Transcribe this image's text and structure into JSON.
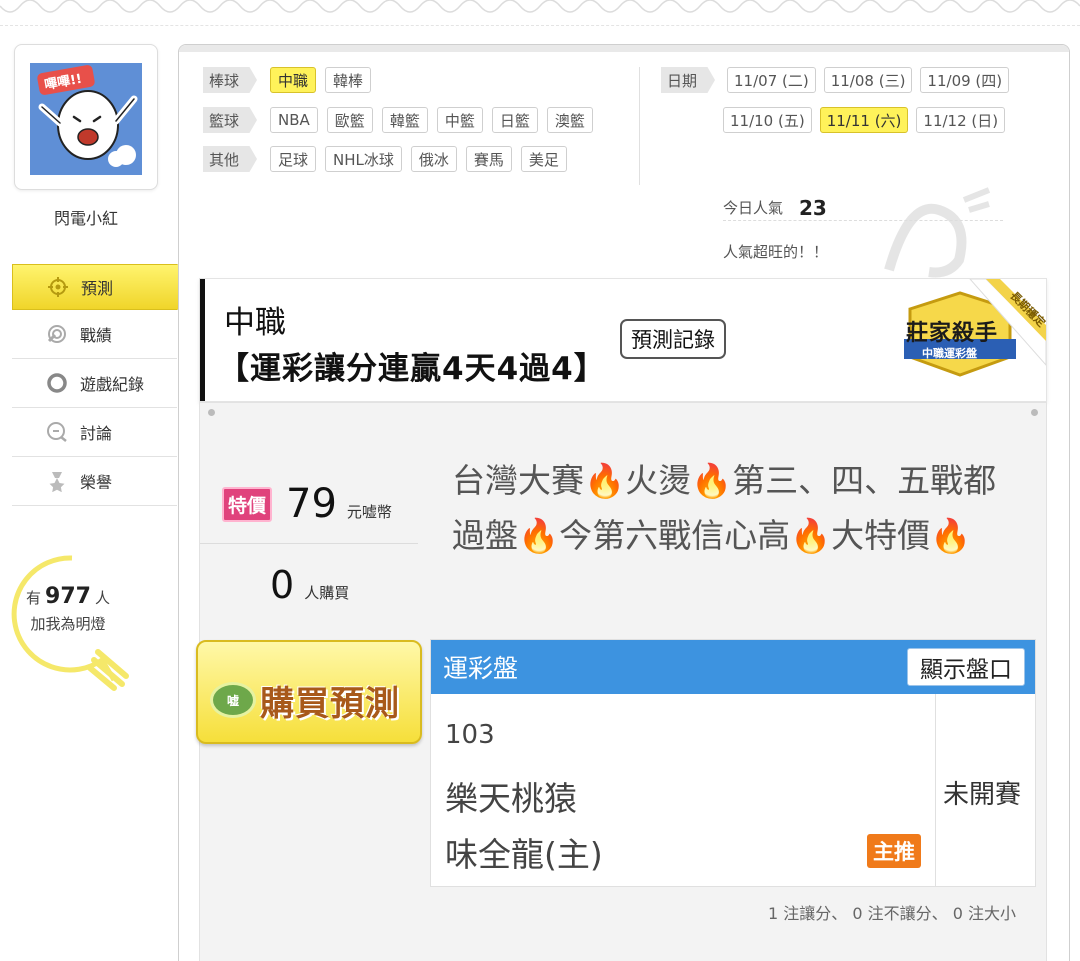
{
  "user": {
    "name": "閃電小紅",
    "avatar_text": "嗶嗶!!"
  },
  "side_nav": [
    {
      "label": "預測",
      "icon": "target-icon",
      "active": true
    },
    {
      "label": "戰績",
      "icon": "record-icon",
      "active": false
    },
    {
      "label": "遊戲紀錄",
      "icon": "circle-icon",
      "active": false
    },
    {
      "label": "討論",
      "icon": "chat-icon",
      "active": false
    },
    {
      "label": "榮譽",
      "icon": "medal-icon",
      "active": false
    }
  ],
  "fans": {
    "prefix": "有",
    "count": "977",
    "suffix": "人",
    "cta": "加我為明燈"
  },
  "categories": [
    {
      "label": "棒球",
      "items": [
        {
          "text": "中職",
          "selected": true
        },
        {
          "text": "韓棒",
          "selected": false
        }
      ]
    },
    {
      "label": "籃球",
      "items": [
        {
          "text": "NBA",
          "selected": false
        },
        {
          "text": "歐籃",
          "selected": false
        },
        {
          "text": "韓籃",
          "selected": false
        },
        {
          "text": "中籃",
          "selected": false
        },
        {
          "text": "日籃",
          "selected": false
        },
        {
          "text": "澳籃",
          "selected": false
        }
      ]
    },
    {
      "label": "其他",
      "items": [
        {
          "text": "足球",
          "selected": false
        },
        {
          "text": "NHL冰球",
          "selected": false
        },
        {
          "text": "俄冰",
          "selected": false
        },
        {
          "text": "賽馬",
          "selected": false
        },
        {
          "text": "美足",
          "selected": false
        }
      ]
    }
  ],
  "dates": {
    "label": "日期",
    "row1": [
      {
        "text": "11/07 (二)",
        "selected": false
      },
      {
        "text": "11/08 (三)",
        "selected": false
      },
      {
        "text": "11/09 (四)",
        "selected": false
      }
    ],
    "row2": [
      {
        "text": "11/10 (五)",
        "selected": false
      },
      {
        "text": "11/11 (六)",
        "selected": true
      },
      {
        "text": "11/12 (日)",
        "selected": false
      }
    ]
  },
  "popularity": {
    "label": "今日人氣",
    "value": "23",
    "message": "人氣超旺的！！"
  },
  "prediction": {
    "league": "中職",
    "subtitle": "【運彩讓分連贏4天4過4】",
    "record_button": "預測記錄",
    "badge_title": "莊家殺手",
    "badge_sub": "中職運彩盤",
    "badge_ribbon": "長期穩定"
  },
  "offer": {
    "tag": "特價",
    "price": "79",
    "unit": "元嘘幣",
    "buyers": "0",
    "buyers_unit": "人購買",
    "buy_button": "購買預測",
    "buy_coin": "嘘"
  },
  "description": "台灣大賽🔥火燙🔥第三、四、五戰都過盤🔥今第六戰信心高🔥大特價🔥",
  "odds": {
    "title": "運彩盤",
    "show_button": "顯示盤口",
    "game_no": "103",
    "team_away": "樂天桃猿",
    "team_home": "味全龍(主)",
    "pick_badge": "主推",
    "status": "未開賽"
  },
  "stats": "1 注讓分、 0 注不讓分、 0 注大小",
  "colors": {
    "accent_yellow": "#fff25a",
    "odds_blue": "#3d93e0",
    "special_pink": "#e0427c",
    "pick_orange": "#f07a1a"
  }
}
